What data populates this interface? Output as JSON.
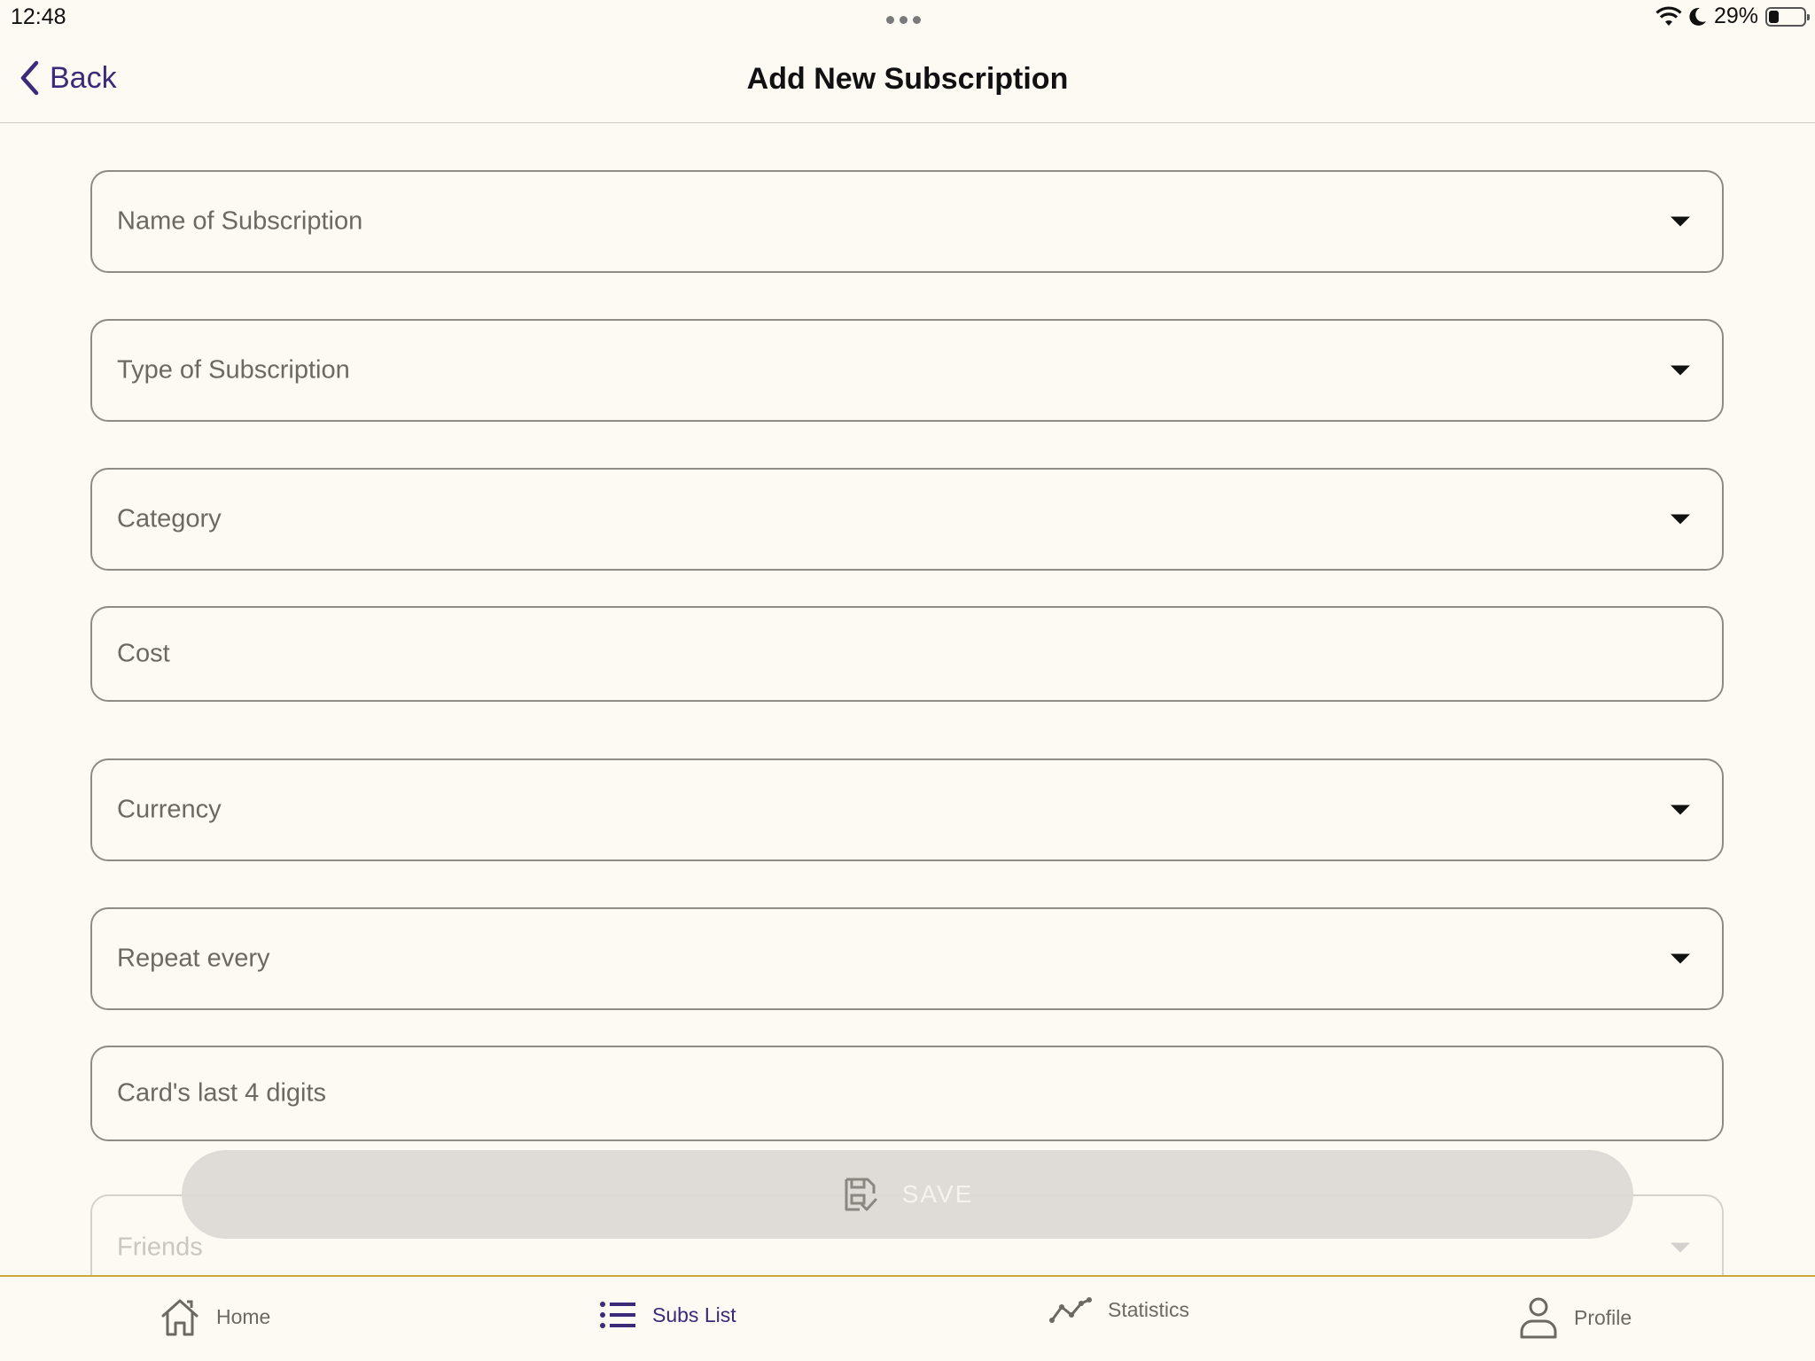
{
  "status_bar": {
    "time": "12:48",
    "battery_percent": "29%",
    "battery_level": 0.29
  },
  "nav": {
    "back_label": "Back",
    "title": "Add New Subscription"
  },
  "form": {
    "fields": [
      {
        "label": "Name of Subscription",
        "dropdown": true
      },
      {
        "label": "Type of Subscription",
        "dropdown": true
      },
      {
        "label": "Category",
        "dropdown": true
      },
      {
        "label": "Cost",
        "dropdown": false
      },
      {
        "label": "Currency",
        "dropdown": true
      },
      {
        "label": "Repeat every",
        "dropdown": true
      },
      {
        "label": "Card's last 4 digits",
        "dropdown": false
      },
      {
        "label": "Friends",
        "dropdown": true
      }
    ],
    "save_label": "SAVE"
  },
  "tabs": [
    {
      "label": "Home",
      "icon": "home-icon",
      "active": false
    },
    {
      "label": "Subs List",
      "icon": "list-icon",
      "active": true
    },
    {
      "label": "Statistics",
      "icon": "chart-line-icon",
      "active": false
    },
    {
      "label": "Profile",
      "icon": "person-icon",
      "active": false
    }
  ],
  "colors": {
    "background": "#fdfaf4",
    "accent": "#3b2a7a",
    "tab_border": "#c9a93a"
  }
}
